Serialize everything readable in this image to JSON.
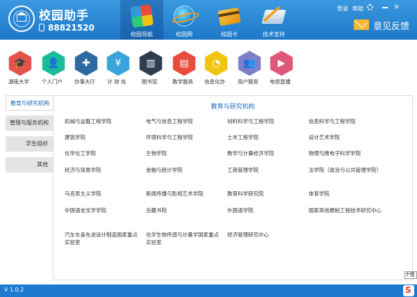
{
  "app": {
    "title": "校园助手",
    "phone": "88821520",
    "version": "V 1.0.2"
  },
  "top_links": {
    "login": "登录",
    "help": "帮助"
  },
  "feedback": {
    "label": "意见反馈"
  },
  "nav": {
    "active": 0,
    "tabs": [
      {
        "label": "校园导航",
        "icon": "campus-nav-icon"
      },
      {
        "label": "校园网",
        "icon": "globe-icon"
      },
      {
        "label": "校园卡",
        "icon": "campus-card-icon"
      },
      {
        "label": "技术支持",
        "icon": "tech-support-icon"
      }
    ]
  },
  "tools": [
    {
      "label": "湖南大学",
      "icon": "graduation-cap-icon",
      "color": "#e5544b"
    },
    {
      "label": "个人门户",
      "icon": "user-icon",
      "color": "#1abc9c"
    },
    {
      "label": "办事大厅",
      "icon": "puzzle-icon",
      "color": "#2c6aa0"
    },
    {
      "label": "计 财 处",
      "icon": "money-bag-icon",
      "color": "#3aa5dc"
    },
    {
      "label": "图书馆",
      "icon": "book-icon",
      "color": "#2c3e50"
    },
    {
      "label": "教学服务",
      "icon": "whiteboard-icon",
      "color": "#e74c3c"
    },
    {
      "label": "信息化办",
      "icon": "pie-chart-icon",
      "color": "#f1c40f"
    },
    {
      "label": "用户服务",
      "icon": "users-icon",
      "color": "#7d7fc9"
    },
    {
      "label": "电视直播",
      "icon": "video-icon",
      "color": "#e0577c"
    }
  ],
  "sidebar": {
    "items": [
      {
        "label": "教育与研究机构"
      },
      {
        "label": "管理与服务机构"
      },
      {
        "label": "学生组织"
      },
      {
        "label": "其他"
      }
    ]
  },
  "panel": {
    "title": "教育与研究机构",
    "colleges": [
      [
        "机械与运载工程学院",
        "电气与信息工程学院",
        "材料科学与工程学院",
        "信息科学与工程学院"
      ],
      [
        "建筑学院",
        "环境科学与工程学院",
        "土木工程学院",
        "设计艺术学院"
      ],
      [
        "化学化工学院",
        "生物学院",
        "数学与计量经济学院",
        "物理与微电子科学学院"
      ],
      [
        "经济与贸易学院",
        "金融与统计学院",
        "工商管理学院",
        "法学院（政治与公共管理学院）"
      ],
      [
        "马克思主义学院",
        "新闻传播与影视艺术学院",
        "教育科学研究院",
        "体育学院"
      ],
      [
        "中国语言文学学院",
        "岳麓书院",
        "外国语学院",
        "国家高效磨削工程技术研究中心"
      ],
      [
        "汽车车身先进设计制造国家重点实验室",
        "化学生物传感与计量学国家重点实验室",
        "经济管理研究中心"
      ]
    ]
  },
  "tooltip": {
    "text": "个性"
  }
}
